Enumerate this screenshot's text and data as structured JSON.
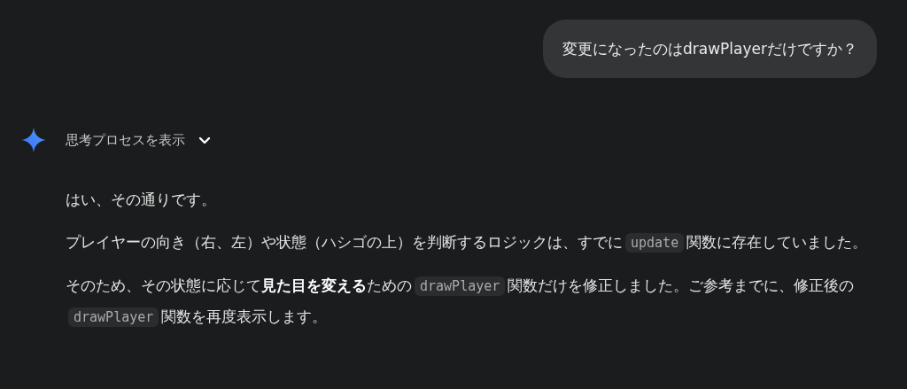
{
  "user_message": {
    "text": "変更になったのはdrawPlayerだけですか？"
  },
  "response": {
    "thinking_toggle": {
      "label": "思考プロセスを表示",
      "expanded": false
    },
    "paragraphs": [
      [
        {
          "kind": "text",
          "text": "はい、その通りです。"
        }
      ],
      [
        {
          "kind": "text",
          "text": "プレイヤーの向き（右、左）や状態（ハシゴの上）を判断するロジックは、すでに"
        },
        {
          "kind": "code",
          "text": "update"
        },
        {
          "kind": "text",
          "text": "関数に存在していました。"
        }
      ],
      [
        {
          "kind": "text",
          "text": "そのため、その状態に応じて**見た目を変える**ための"
        },
        {
          "kind": "code",
          "text": "drawPlayer"
        },
        {
          "kind": "text",
          "text": "関数だけを修正しました。ご参考までに、修正後の"
        },
        {
          "kind": "code",
          "text": "drawPlayer"
        },
        {
          "kind": "text",
          "text": "関数を再度表示します。"
        }
      ]
    ]
  }
}
